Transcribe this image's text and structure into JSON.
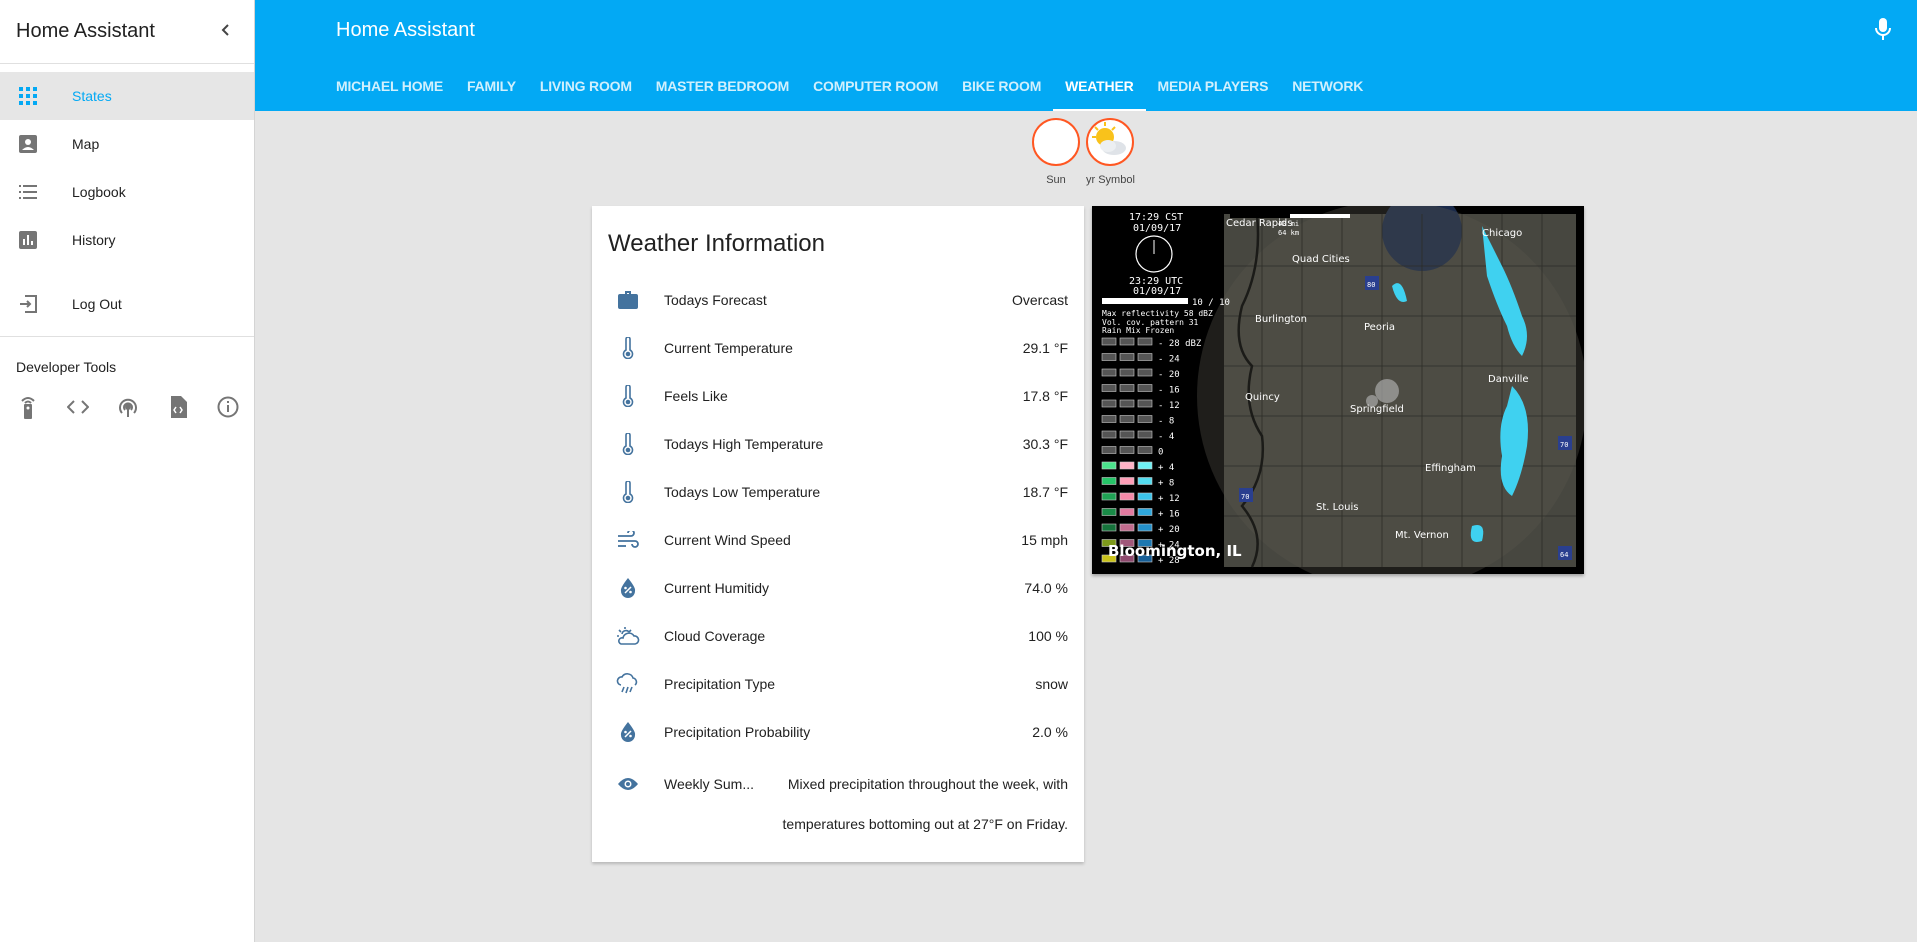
{
  "sidebar": {
    "title": "Home Assistant",
    "items": [
      {
        "label": "States",
        "icon": "grid-icon"
      },
      {
        "label": "Map",
        "icon": "account-box-icon"
      },
      {
        "label": "Logbook",
        "icon": "list-icon"
      },
      {
        "label": "History",
        "icon": "chart-icon"
      },
      {
        "label": "Log Out",
        "icon": "exit-icon"
      }
    ],
    "dev_tools_title": "Developer Tools"
  },
  "header": {
    "title": "Home Assistant",
    "tabs": [
      "MICHAEL HOME",
      "FAMILY",
      "LIVING ROOM",
      "MASTER BEDROOM",
      "COMPUTER ROOM",
      "BIKE ROOM",
      "WEATHER",
      "MEDIA PLAYERS",
      "NETWORK"
    ],
    "active_tab": "WEATHER"
  },
  "badges": [
    {
      "label": "Sun",
      "icon": "moon-icon"
    },
    {
      "label": "yr Symbol",
      "icon": "partly-cloudy-icon"
    }
  ],
  "weather": {
    "title": "Weather Information",
    "rows": [
      {
        "label": "Todays Forecast",
        "value": "Overcast",
        "icon": "briefcase-icon"
      },
      {
        "label": "Current Temperature",
        "value": "29.1 °F",
        "icon": "thermometer-icon"
      },
      {
        "label": "Feels Like",
        "value": "17.8 °F",
        "icon": "thermometer-icon"
      },
      {
        "label": "Todays High Temperature",
        "value": "30.3 °F",
        "icon": "thermometer-icon"
      },
      {
        "label": "Todays Low Temperature",
        "value": "18.7 °F",
        "icon": "thermometer-icon"
      },
      {
        "label": "Current Wind Speed",
        "value": "15 mph",
        "icon": "wind-icon"
      },
      {
        "label": "Current Humitidy",
        "value": "74.0 %",
        "icon": "water-percent-icon"
      },
      {
        "label": "Cloud Coverage",
        "value": "100 %",
        "icon": "weather-partly-cloudy-icon"
      },
      {
        "label": "Precipitation Type",
        "value": "snow",
        "icon": "rainy-icon"
      },
      {
        "label": "Precipitation Probability",
        "value": "2.0 %",
        "icon": "water-percent-icon"
      }
    ],
    "summary": {
      "label": "Weekly Sum...",
      "value": "Mixed precipitation throughout the week, with temperatures bottoming out at 27°F on Friday.",
      "icon": "eye-icon"
    }
  },
  "radar": {
    "time_local": "17:29  CST",
    "date_local": "01/09/17",
    "time_utc": "23:29  UTC",
    "date_utc": "01/09/17",
    "frames": "10 / 10",
    "max_reflectivity": "Max  reflectivity  58  dBZ",
    "vcp": "Vol.  cov.  pattern  31",
    "legend_header": "Rain  Mix  Frozen",
    "scale": [
      "- 28  dBZ",
      "- 24",
      "- 20",
      "- 16",
      "- 12",
      "- 8",
      "- 4",
      "0",
      "+ 4",
      "+ 8",
      "+ 12",
      "+ 16",
      "+ 20",
      "+ 24",
      "+ 28"
    ],
    "distance": "64 km",
    "distance_unit": "40 mi",
    "location": "Bloomington, IL",
    "cities": [
      "Cedar Rapids",
      "Chicago",
      "Quad Cities",
      "Burlington",
      "Peoria",
      "Quincy",
      "Danville",
      "Springfield",
      "Effingham",
      "St. Louis",
      "Mt. Vernon"
    ],
    "highways": [
      "80",
      "70",
      "70",
      "64"
    ]
  },
  "colors": {
    "primary": "#03a9f4",
    "icon": "#44739e",
    "badge_border": "#ff5722"
  }
}
